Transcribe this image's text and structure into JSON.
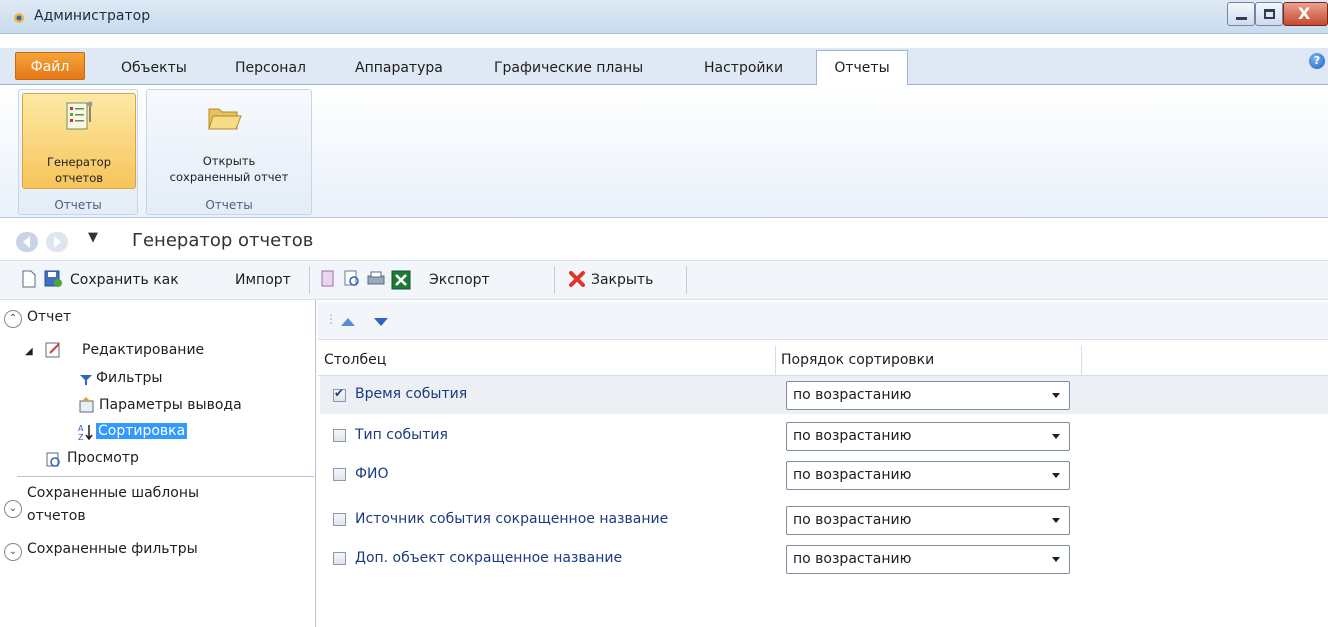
{
  "window": {
    "title": "Администратор"
  },
  "ribbon": {
    "tabs": [
      {
        "label": "Файл"
      },
      {
        "label": "Объекты"
      },
      {
        "label": "Персонал"
      },
      {
        "label": "Аппаратура"
      },
      {
        "label": "Графические планы"
      },
      {
        "label": "Настройки"
      },
      {
        "label": "Отчеты"
      }
    ],
    "buttons": {
      "generator_line1": "Генератор",
      "generator_line2": "отчетов",
      "open_line1": "Открыть",
      "open_line2": "сохраненный отчет"
    },
    "groups": {
      "group1": "Отчеты",
      "group2": "Отчеты"
    }
  },
  "nav": {
    "title": "Генератор отчетов"
  },
  "toolbar": {
    "save_as": "Сохранить как",
    "import": "Импорт",
    "export": "Экспорт",
    "close": "Закрыть"
  },
  "left_panel": {
    "report_header": "Отчет",
    "tree": {
      "editing": "Редактирование",
      "filters": "Фильтры",
      "output_params": "Параметры вывода",
      "sorting": "Сортировка",
      "preview": "Просмотр"
    },
    "saved_templates_line1": "Сохраненные шаблоны",
    "saved_templates_line2": "отчетов",
    "saved_filters": "Сохраненные фильтры"
  },
  "grid": {
    "col_column": "Столбец",
    "col_sort_order": "Порядок сортировки",
    "rows": [
      {
        "name": "Время события",
        "checked": true,
        "order": "по возрастанию"
      },
      {
        "name": "Тип события",
        "checked": false,
        "order": "по возрастанию"
      },
      {
        "name": "ФИО",
        "checked": false,
        "order": "по возрастанию"
      },
      {
        "name": "Источник события сокращенное название",
        "checked": false,
        "order": "по возрастанию"
      },
      {
        "name": "Доп. объект сокращенное название",
        "checked": false,
        "order": "по возрастанию"
      }
    ]
  },
  "icons": {
    "app": "app-icon",
    "help": "help-icon",
    "generator": "report-generator-icon",
    "open_folder": "folder-open-icon",
    "new": "new-document-icon",
    "save": "save-icon",
    "excel": "excel-icon",
    "close": "close-x-icon"
  }
}
